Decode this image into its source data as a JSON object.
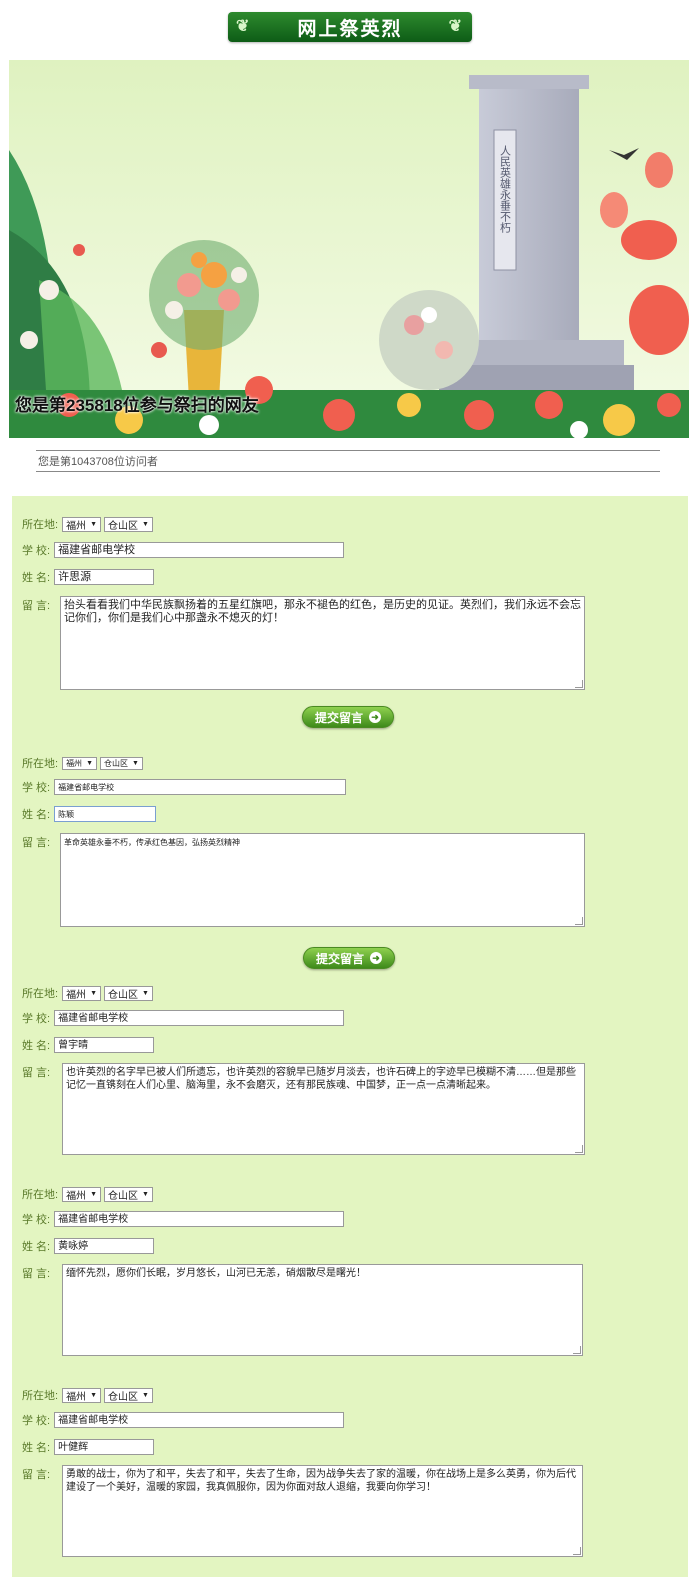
{
  "header": {
    "title": "网上祭英烈",
    "ornament_left": "❦",
    "ornament_right": "❦"
  },
  "hero": {
    "caption": "您是第235818位参与祭扫的网友",
    "monument_inscription": "人民英雄永垂不朽"
  },
  "visitor_text": "您是第1043708位访问者",
  "labels": {
    "location": "所在地:",
    "school": "学 校:",
    "name": "姓 名:",
    "message": "留 言:"
  },
  "submit": {
    "label": "提交留言",
    "arrow": "➜"
  },
  "entries": [
    {
      "city": "福州",
      "district": "仓山区",
      "school": "福建省邮电学校",
      "name": "许思源",
      "message": "抬头看看我们中华民族飘扬着的五星红旗吧，那永不褪色的红色，是历史的见证。英烈们，我们永远不会忘记你们，你们是我们心中那盏永不熄灭的灯！"
    },
    {
      "city": "福州",
      "district": "仓山区",
      "school": "福建省邮电学校",
      "name": "陈颖",
      "message": "革命英雄永垂不朽，传承红色基因，弘扬英烈精神"
    },
    {
      "city": "福州",
      "district": "仓山区",
      "school": "福建省邮电学校",
      "name": "曾宇晴",
      "message": "也许英烈的名字早已被人们所遗忘，也许英烈的容貌早已随岁月淡去，也许石碑上的字迹早已模糊不清……但是那些记忆一直镌刻在人们心里、脑海里，永不会磨灭，还有那民族魂、中国梦，正一点一点清晰起来。"
    },
    {
      "city": "福州",
      "district": "仓山区",
      "school": "福建省邮电学校",
      "name": "黄咏婷",
      "message": "缅怀先烈，愿你们长眠，岁月悠长，山河已无恙，硝烟散尽是曙光！"
    },
    {
      "city": "福州",
      "district": "仓山区",
      "school": "福建省邮电学校",
      "name": "叶健辉",
      "message": "勇敢的战士，你为了和平，失去了和平，失去了生命，因为战争失去了家的温暖，你在战场上是多么英勇，你为后代建设了一个美好，温暖的家园，我真佩服你，因为你面对敌人退缩，我要向你学习！"
    }
  ]
}
